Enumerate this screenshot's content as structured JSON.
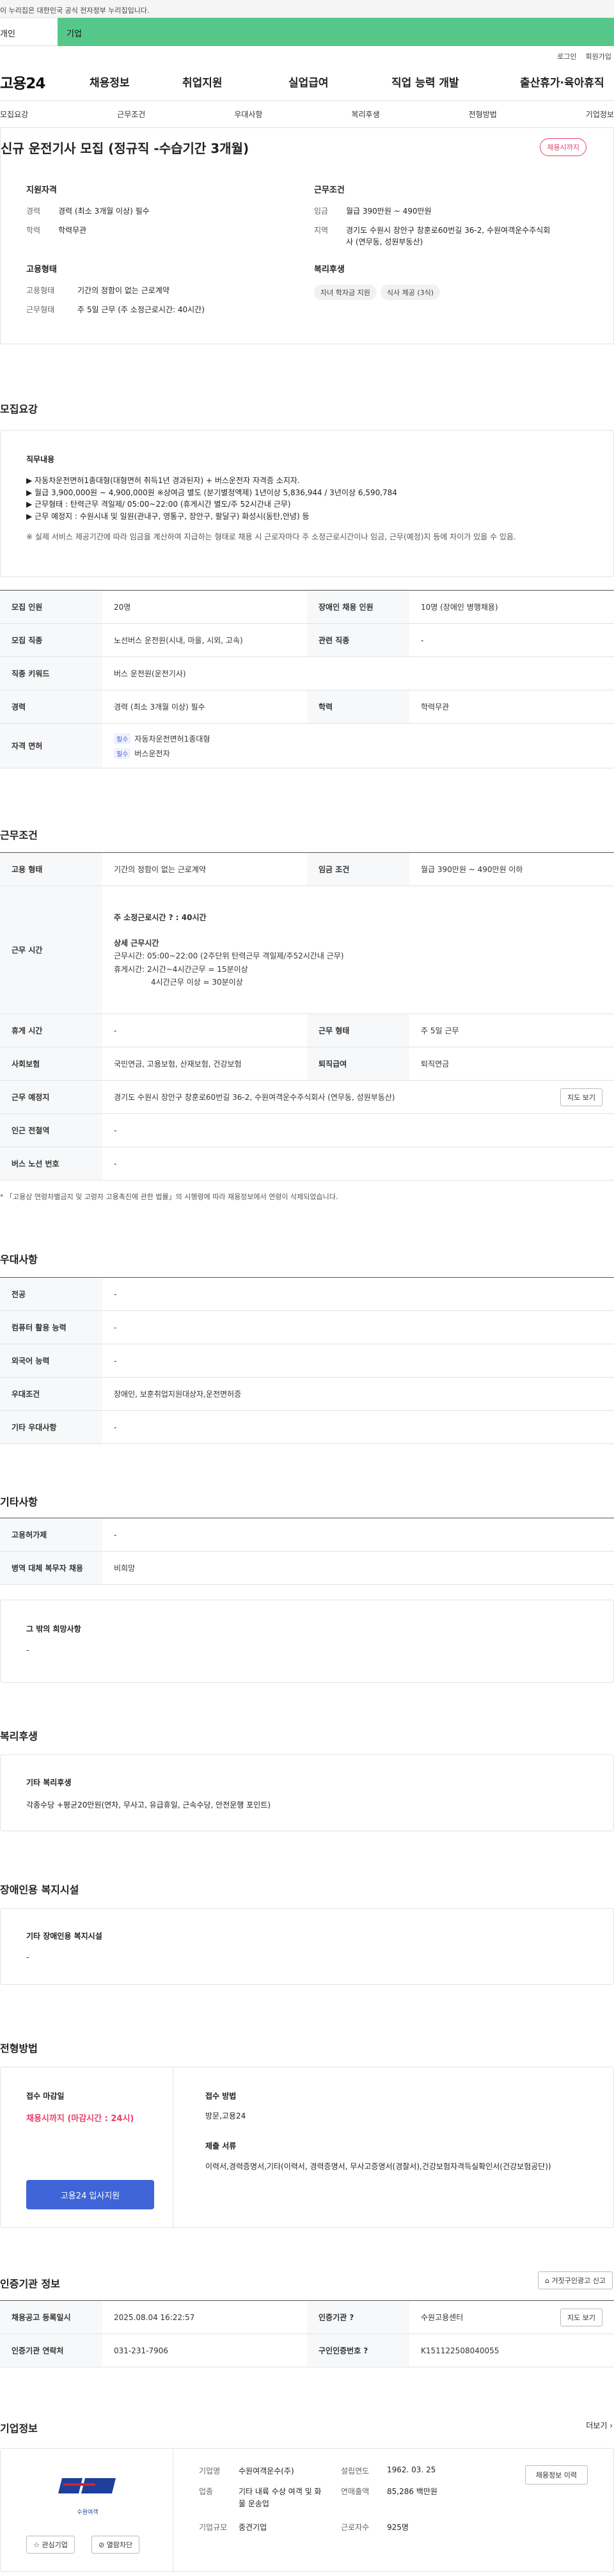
{
  "gov_banner": "이 누리집은 대한민국 공식 전자정부 누리집입니다.",
  "top_tabs": [
    "개인",
    "기업"
  ],
  "util_links": [
    "로그인",
    "회원가입"
  ],
  "logo": "고용24",
  "gnb": [
    "채용정보",
    "취업지원",
    "실업급여",
    "직업 능력 개발",
    "출산휴가·육아휴직"
  ],
  "subnav": [
    "모집요강",
    "근무조건",
    "우대사항",
    "복리후생",
    "전형방법",
    "기업정보"
  ],
  "summary": {
    "title": "신규 운전기사 모집 (정규직 -수습기간 3개월)",
    "badge": "채용시까지",
    "qual_title": "지원자격",
    "qual": [
      {
        "k": "경력",
        "v": "경력 (최소 3개월 이상) 필수"
      },
      {
        "k": "학력",
        "v": "학력무관"
      }
    ],
    "cond_title": "근무조건",
    "cond": [
      {
        "k": "임금",
        "v": "월급 390만원 ~ 490만원"
      },
      {
        "k": "지역",
        "v": "경기도 수원시 장안구 창훈로60번길 36-2, 수원여객운수주식회사 (연무동, 성원부동산)"
      }
    ],
    "emp_title": "고용형태",
    "emp": [
      {
        "k": "고용형태",
        "v": "기간의 정함이 없는 근로계약"
      },
      {
        "k": "근무형태",
        "v": "주 5일 근무 (주 소정근로시간: 40시간)"
      }
    ],
    "welfare_title": "복리후생",
    "welfare_chips": [
      "자녀 학자금 지원",
      "식사 제공 (3식)"
    ]
  },
  "recruit": {
    "title": "모집요강",
    "duty_title": "직무내용",
    "duty_lines": [
      "▶ 자동차운전면허1종대형(대형면허 취득1년 경과된자) + 버스운전자 자격증 소지자.",
      "▶ 월급 3,900,000원 ~ 4,900,000원    ※상여금 별도 (분기별정액제) 1년이상 5,836,944 / 3년이상 6,590,784",
      "▶ 근무형태 : 탄력근무 격일제/ 05:00~22:00 (휴게시간 별도/주 52시간내 근무)",
      "▶ 근무 예정지 : 수원시내 및 일원(관내구, 영통구, 장안구, 팔달구) 화성시(동탄,안녕) 등"
    ],
    "duty_note": "※ 실제 서비스 제공기간에 따라 임금을 계산하여 지급하는 형태로 채용 시 근로자마다 주 소정근로시간이나 임금, 근무(예정)지 등에 차이가 있을 수 있음.",
    "rows": [
      {
        "k": "모집 인원",
        "v": "20명",
        "k2": "장애인 채용 인원",
        "v2": "10명 (장애인 병행채용)"
      },
      {
        "k": "모집 직종",
        "v": "노선버스 운전원(시내, 마을, 시외, 고속)",
        "k2": "관련 직종",
        "v2": "-"
      },
      {
        "k": "직종 키워드",
        "v": "버스 운전원(운전기사)"
      },
      {
        "k": "경력",
        "v": "경력 (최소 3개월 이상) 필수",
        "k2": "학력",
        "v2": "학력무관"
      }
    ],
    "license_label": "자격 면허",
    "license_pill": "필수",
    "licenses": [
      "자동차운전면허1종대형",
      "버스운전자"
    ]
  },
  "work": {
    "title": "근무조건",
    "type_k": "고용 형태",
    "type_v": "기간의 정함이 없는 근로계약",
    "wage_k": "임금 조건",
    "wage_v": "월급 390만원 ~ 490만원 이하",
    "time_k": "근무 시간",
    "time_hours": "주 소정근로시간 ? : 40시간",
    "time_detail_title": "상세 근무시간",
    "time_detail": [
      "근무시간: 05:00~22:00 (2주단위 탄력근무 격일제/주52시간내 근무)",
      "휴게시간: 2시간~4시간근무 = 15분이상",
      "4시간근무 이상 = 30분이상"
    ],
    "rows": [
      {
        "k": "휴게 시간",
        "v": "-",
        "k2": "근무 형태",
        "v2": "주 5일 근무"
      },
      {
        "k": "사회보험",
        "v": "국민연금, 고용보험, 산재보험, 건강보험",
        "k2": "퇴직급여",
        "v2": "퇴직연금"
      }
    ],
    "place_k": "근무 예정지",
    "place_v": "경기도 수원시 장안구 창훈로60번길 36-2, 수원여객운수주식회사 (연무동, 성원부동산)",
    "map_btn": "지도 보기",
    "rows2": [
      {
        "k": "인근 전철역",
        "v": "-"
      },
      {
        "k": "버스 노선 번호",
        "v": "-"
      }
    ],
    "note": "* 「고용상 연령차별금지 및 고령자 고용촉진에 관한 법률」의 시행령에 따라 채용정보에서 연령이 삭제되었습니다."
  },
  "pref": {
    "title": "우대사항",
    "rows": [
      {
        "k": "전공",
        "v": "-"
      },
      {
        "k": "컴퓨터 활용 능력",
        "v": "-"
      },
      {
        "k": "외국어 능력",
        "v": "-"
      },
      {
        "k": "우대조건",
        "v": "장애인, 보훈취업지원대상자,운전면허증"
      },
      {
        "k": "기타 우대사항",
        "v": "-"
      }
    ]
  },
  "etc": {
    "title": "기타사항",
    "rows": [
      {
        "k": "고용허가제",
        "v": "-"
      },
      {
        "k": "병역 대체 복무자 채용",
        "v": "비희망"
      }
    ],
    "hope_title": "그 밖의 희망사항",
    "hope_v": "-"
  },
  "benefit": {
    "title": "복리후생",
    "sub": "기타 복리후생",
    "v": "각종수당 +평균20만원(연차, 무사고, 유급휴일, 근속수당, 안전운행 포인트)"
  },
  "facility": {
    "title": "장애인용 복지시설",
    "sub": "기타 장애인용 복지시설",
    "v": "-"
  },
  "process": {
    "title": "전형방법",
    "deadline_k": "접수 마감일",
    "deadline_v": "채용시까지 (마감시간 : 24시)",
    "apply_btn": "고용24 입사지원",
    "method_k": "접수 방법",
    "method_v": "방문,고용24",
    "docs_k": "제출 서류",
    "docs_v": "이력서,경력증명서,기타(이력서, 경력증명서, 무사고증명서(경찰서),건강보험자격득실확인서(건강보험공단))"
  },
  "cert": {
    "title": "인증기관 정보",
    "report_btn": "거짓구인광고 신고",
    "rows": [
      {
        "k": "채용공고 등록일시",
        "v": "2025.08.04 16:22:57",
        "k2": "인증기관 ?",
        "v2": "수원고용센터",
        "btn": "지도 보기"
      },
      {
        "k": "인증기관 연락처",
        "v": "031-231-7906",
        "k2": "구인인증번호 ?",
        "v2": "K151122508040055"
      }
    ]
  },
  "company": {
    "title": "기업정보",
    "more": "더보기",
    "fav_btn": "관심기업",
    "block_btn": "열람차단",
    "logo_text": "수원여객",
    "fields": [
      {
        "k": "기업명",
        "v": "수원여객운수(주)",
        "k2": "설립연도",
        "v2": "1962. 03. 25"
      },
      {
        "k": "업종",
        "v": "기타 내륙 수상 여객 및 화물 운송업",
        "k2": "연매출액",
        "v2": "85,286 백만원"
      },
      {
        "k": "기업규모",
        "v": "중견기업",
        "k2": "근로자수",
        "v2": "925명"
      }
    ],
    "history_btn": "채용정보 이력"
  }
}
